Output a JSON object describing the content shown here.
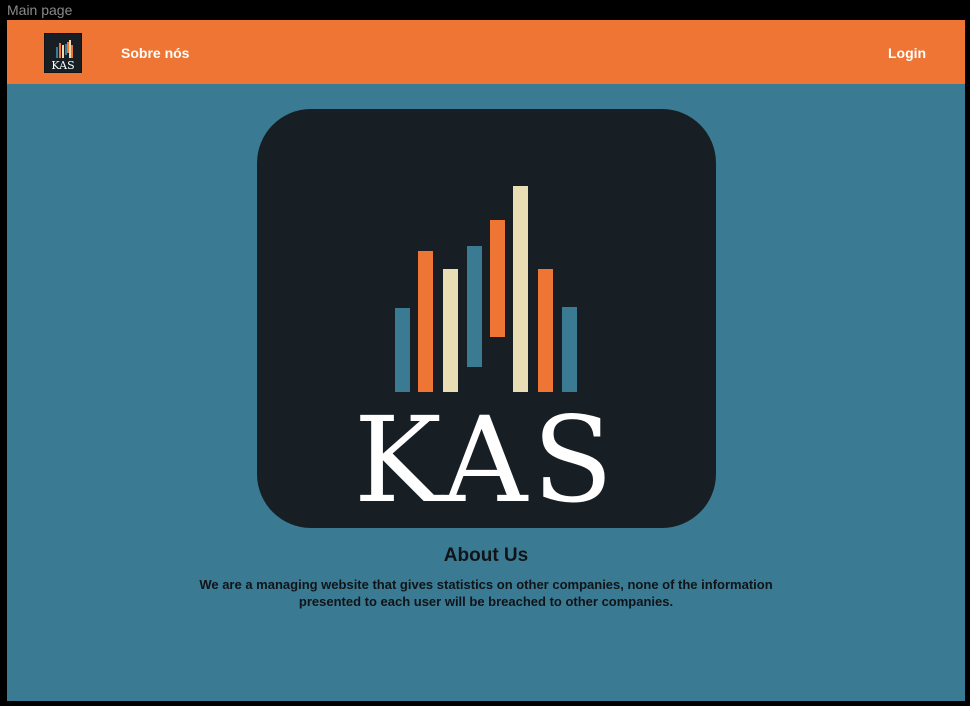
{
  "frame": {
    "title": "Main page"
  },
  "navbar": {
    "logo_text": "KAS",
    "about_label": "Sobre nós",
    "login_label": "Login"
  },
  "hero": {
    "logo_text": "KAS"
  },
  "about": {
    "title": "About Us",
    "description": "We are a managing website that gives statistics on other companies, none of the information presented to each user will be breached to other companies."
  },
  "colors": {
    "navbar": "#ee7533",
    "page_background": "#3a7b93",
    "logo_background": "#181f24",
    "bar_blue": "#3a7b93",
    "bar_orange": "#ee7533",
    "bar_cream": "#e9ddb4"
  }
}
